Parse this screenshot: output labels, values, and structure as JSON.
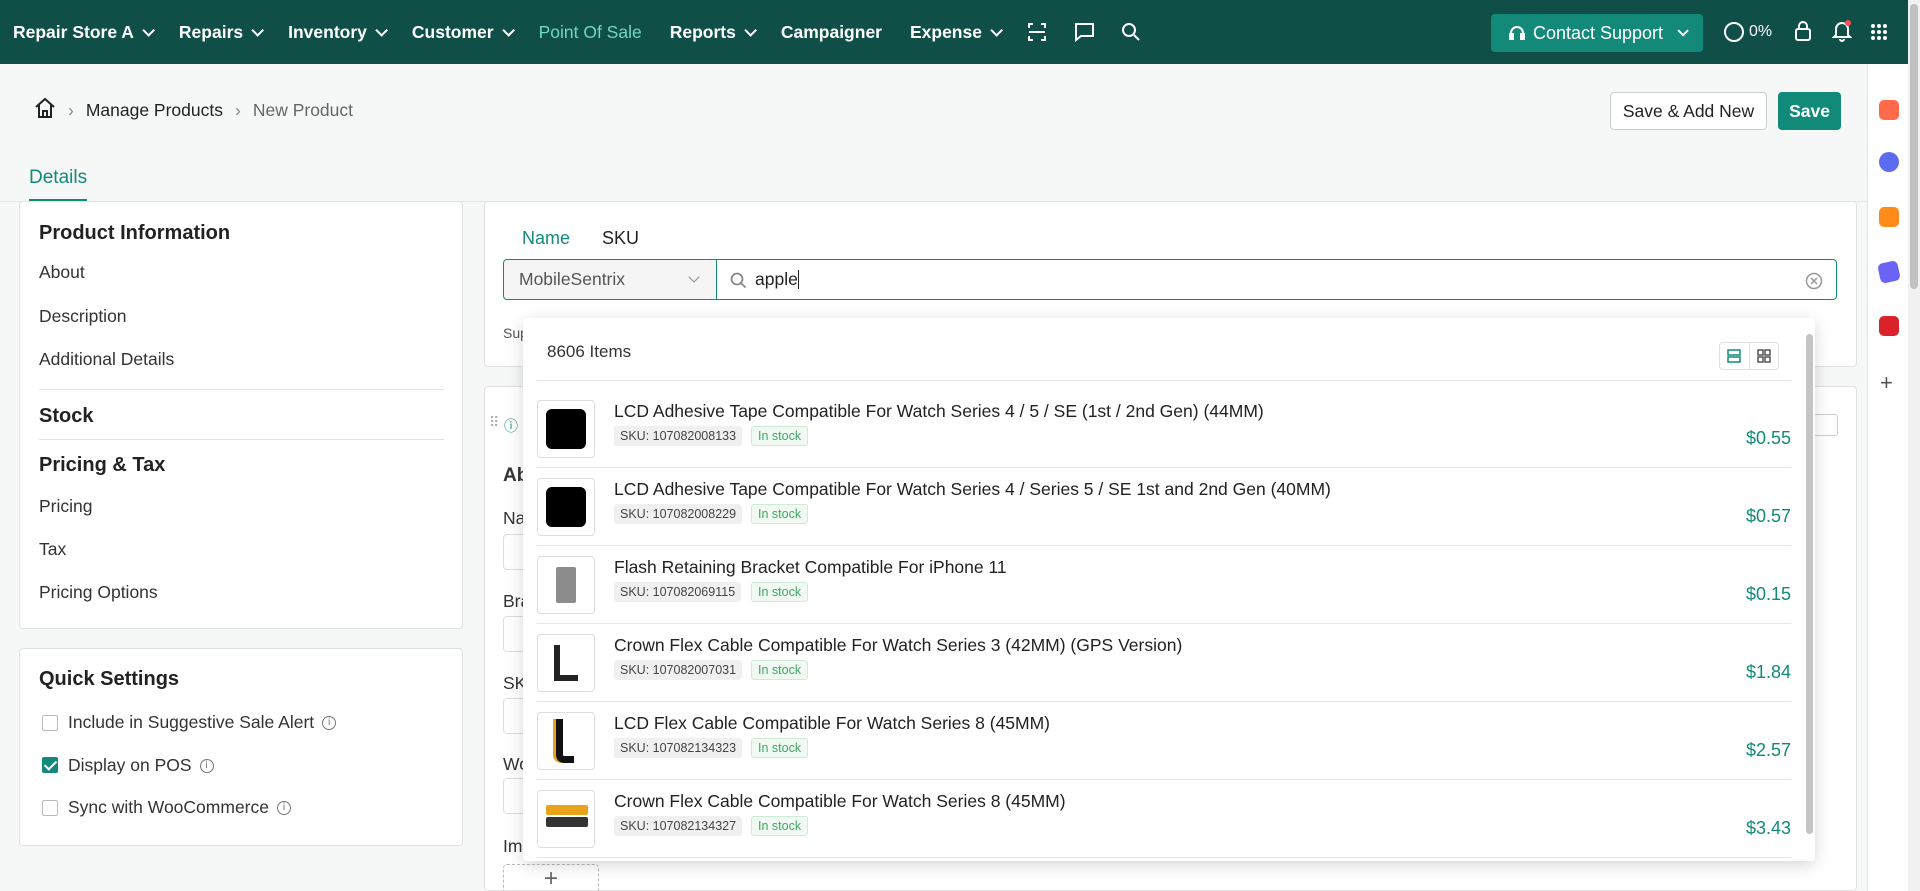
{
  "topnav": {
    "store": "Repair Store A",
    "items": [
      "Repairs",
      "Inventory",
      "Customer",
      "Point Of Sale",
      "Reports",
      "Campaigner",
      "Expense"
    ],
    "support": "Contact Support",
    "progress": "0%"
  },
  "breadcrumb": {
    "parent": "Manage Products",
    "current": "New Product"
  },
  "actions": {
    "save_add": "Save & Add New",
    "save": "Save"
  },
  "tab": "Details",
  "sidebar": {
    "product_info": "Product Information",
    "about": "About",
    "description": "Description",
    "additional": "Additional Details",
    "stock": "Stock",
    "pricing_tax": "Pricing & Tax",
    "pricing": "Pricing",
    "tax": "Tax",
    "pricing_options": "Pricing Options"
  },
  "quick": {
    "title": "Quick Settings",
    "opt1": "Include in Suggestive Sale Alert",
    "opt2": "Display on POS",
    "opt3": "Sync with WooCommerce",
    "opt1_checked": false,
    "opt2_checked": true,
    "opt3_checked": false
  },
  "search": {
    "tab_name": "Name",
    "tab_sku": "SKU",
    "supplier": "MobileSentrix",
    "query": "apple",
    "count": "8606 Items"
  },
  "partial_labels": {
    "sup": "Sup",
    "ab": "Ab",
    "na": "Na",
    "bra": "Bra",
    "sk": "SK",
    "wo": "Wo",
    "im": "Im"
  },
  "results": [
    {
      "name": "LCD Adhesive Tape Compatible For Watch Series 4 / 5 / SE (1st / 2nd Gen) (44MM)",
      "sku": "SKU: 107082008133",
      "stock": "In stock",
      "price": "$0.55"
    },
    {
      "name": "LCD Adhesive Tape Compatible For Watch Series 4 / Series 5 / SE 1st and 2nd Gen (40MM)",
      "sku": "SKU: 107082008229",
      "stock": "In stock",
      "price": "$0.57"
    },
    {
      "name": "Flash Retaining Bracket Compatible For iPhone 11",
      "sku": "SKU: 107082069115",
      "stock": "In stock",
      "price": "$0.15"
    },
    {
      "name": "Crown Flex Cable Compatible For Watch Series 3 (42MM) (GPS Version)",
      "sku": "SKU: 107082007031",
      "stock": "In stock",
      "price": "$1.84"
    },
    {
      "name": "LCD Flex Cable Compatible For Watch Series 8 (45MM)",
      "sku": "SKU: 107082134323",
      "stock": "In stock",
      "price": "$2.57"
    },
    {
      "name": "Crown Flex Cable Compatible For Watch Series 8 (45MM)",
      "sku": "SKU: 107082134327",
      "stock": "In stock",
      "price": "$3.43"
    }
  ],
  "colors": {
    "nav": "#0f4f47",
    "accent": "#128a7a"
  }
}
